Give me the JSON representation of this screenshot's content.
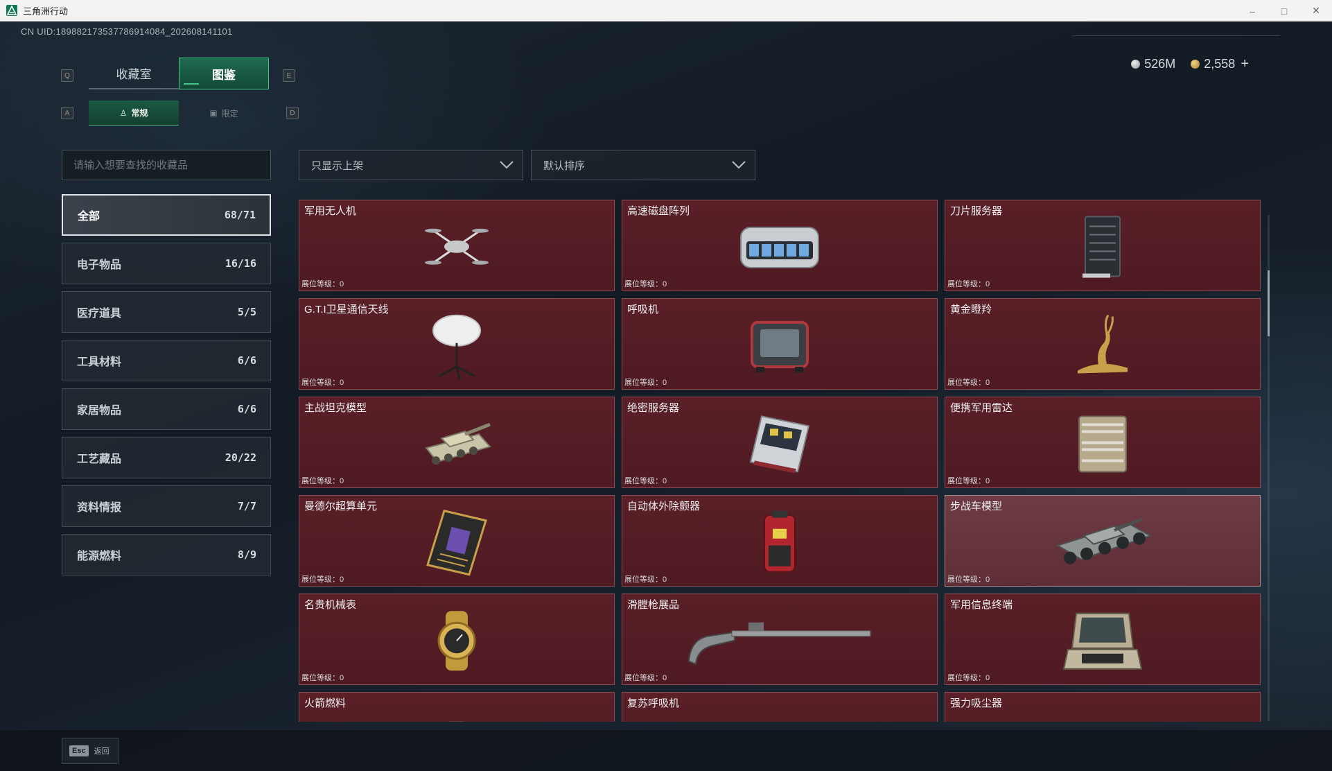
{
  "window": {
    "title": "三角洲行动",
    "controls": [
      "–",
      "□",
      "✕"
    ]
  },
  "header": {
    "uid": "CN UID:189882173537786914084_202608141101",
    "currency": {
      "silver": "526M",
      "gold": "2,558",
      "add_label": "+"
    }
  },
  "keyhints": {
    "left_tab": "Q",
    "right_tab": "E",
    "left_sub": "A",
    "right_sub": "D"
  },
  "tabs": [
    {
      "label": "收藏室",
      "active": false
    },
    {
      "label": "图鉴",
      "active": true
    }
  ],
  "subtabs": [
    {
      "label": "常规",
      "icon": "figure-icon",
      "active": true
    },
    {
      "label": "限定",
      "icon": "picture-icon",
      "active": false
    }
  ],
  "search": {
    "placeholder": "请输入想要查找的收藏品"
  },
  "filters": {
    "display": "只显示上架",
    "sort": "默认排序"
  },
  "categories": [
    {
      "label": "全部",
      "count": "68/71",
      "active": true
    },
    {
      "label": "电子物品",
      "count": "16/16"
    },
    {
      "label": "医疗道具",
      "count": "5/5"
    },
    {
      "label": "工具材料",
      "count": "6/6"
    },
    {
      "label": "家居物品",
      "count": "6/6"
    },
    {
      "label": "工艺藏品",
      "count": "20/22"
    },
    {
      "label": "资料情报",
      "count": "7/7"
    },
    {
      "label": "能源燃料",
      "count": "8/9"
    }
  ],
  "level_label": "展位等级：0",
  "items": [
    {
      "name": "军用无人机",
      "icon": "drone-icon"
    },
    {
      "name": "高速磁盘阵列",
      "icon": "disk-array-icon"
    },
    {
      "name": "刀片服务器",
      "icon": "blade-server-icon"
    },
    {
      "name": "G.T.I卫星通信天线",
      "icon": "satellite-dish-icon"
    },
    {
      "name": "呼吸机",
      "icon": "ventilator-icon"
    },
    {
      "name": "黄金瞪羚",
      "icon": "golden-gazelle-icon"
    },
    {
      "name": "主战坦克模型",
      "icon": "tank-model-icon"
    },
    {
      "name": "绝密服务器",
      "icon": "secret-server-icon"
    },
    {
      "name": "便携军用雷达",
      "icon": "portable-radar-icon"
    },
    {
      "name": "曼德尔超算单元",
      "icon": "supercomputer-unit-icon"
    },
    {
      "name": "自动体外除颤器",
      "icon": "defibrillator-icon"
    },
    {
      "name": "步战车模型",
      "icon": "ifv-model-icon",
      "hover": true
    },
    {
      "name": "名贵机械表",
      "icon": "watch-icon"
    },
    {
      "name": "滑膛枪展品",
      "icon": "musket-icon"
    },
    {
      "name": "军用信息终端",
      "icon": "info-terminal-icon"
    },
    {
      "name": "火箭燃料",
      "icon": "rocket-fuel-icon"
    },
    {
      "name": "复苏呼吸机",
      "icon": "resus-ventilator-icon"
    },
    {
      "name": "强力吸尘器",
      "icon": "vacuum-icon"
    }
  ],
  "footer": {
    "esc_key": "Esc",
    "back_label": "返回"
  },
  "colors": {
    "accent": "#49c48a",
    "card": "#561d25",
    "card_border": "#8c4a52"
  }
}
